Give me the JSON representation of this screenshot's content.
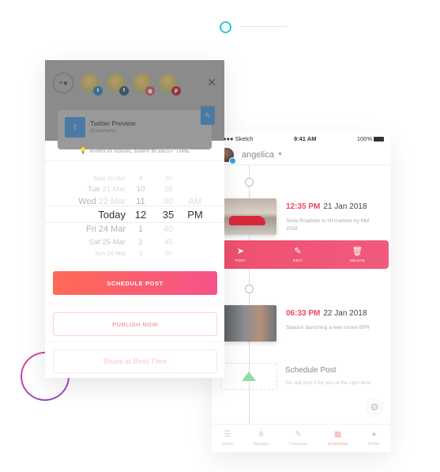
{
  "right_phone": {
    "status": {
      "carrier": "●●● Sketch",
      "time": "9:41 AM",
      "battery": "100%"
    },
    "username": "angelica",
    "posts": [
      {
        "time": "12:35 PM",
        "date": "21 Jan 2018",
        "description": "Tesla Roadster to hit markets by Mid 2018"
      },
      {
        "time": "06:33 PM",
        "date": "22 Jan 2018",
        "description": "SpaceX launching a new rocket BFR"
      }
    ],
    "actions": [
      {
        "label": "POST",
        "icon": "paper-plane-icon"
      },
      {
        "label": "EDIT",
        "icon": "pencil-icon"
      },
      {
        "label": "DELETE",
        "icon": "trash-icon"
      }
    ],
    "schedule_placeholder": {
      "title": "Schedule Post",
      "subtitle": "We will post it for you at the right time"
    },
    "tabs": [
      {
        "label": "Home",
        "icon": "list-icon",
        "active": false
      },
      {
        "label": "Manage",
        "icon": "network-icon",
        "active": false
      },
      {
        "label": "Compose",
        "icon": "compose-icon",
        "active": false
      },
      {
        "label": "Scheduled",
        "icon": "calendar-clock-icon",
        "active": true
      },
      {
        "label": "Profile",
        "icon": "person-icon",
        "active": false
      }
    ]
  },
  "left_phone": {
    "accounts": [
      {
        "network": "twitter",
        "color": "#34a5e9",
        "glyph": "t"
      },
      {
        "network": "facebook",
        "color": "#3b5998",
        "glyph": "f"
      },
      {
        "network": "instagram",
        "color": "#e1306c",
        "glyph": "◎"
      },
      {
        "network": "pinterest",
        "color": "#cb2027",
        "glyph": "p"
      }
    ],
    "preview": {
      "title": "Twitter Preview",
      "username": "@username"
    },
    "hint": "When in doubt, share at BEST TIME",
    "picker": {
      "rows": [
        {
          "day": "Mon",
          "date": "20 Mar",
          "hour": "9",
          "minute": "20",
          "ampm": ""
        },
        {
          "day": "Tue",
          "date": "21 Mar",
          "hour": "10",
          "minute": "25",
          "ampm": ""
        },
        {
          "day": "Wed",
          "date": "22 Mar",
          "hour": "11",
          "minute": "30",
          "ampm": "AM"
        },
        {
          "day": "Today",
          "date": "",
          "hour": "12",
          "minute": "35",
          "ampm": "PM"
        },
        {
          "day": "Fri",
          "date": "24 Mar",
          "hour": "1",
          "minute": "40",
          "ampm": ""
        },
        {
          "day": "Sat",
          "date": "25 Mar",
          "hour": "2",
          "minute": "45",
          "ampm": ""
        },
        {
          "day": "Sun",
          "date": "26 Mar",
          "hour": "3",
          "minute": "50",
          "ampm": ""
        }
      ]
    },
    "buttons": {
      "schedule": "SCHEDULE POST",
      "publish": "PUBLISH NOW",
      "best_time": "Share at Best Time"
    }
  },
  "colors": {
    "accent": "#ef4562",
    "gradient_start": "#ff6a55",
    "gradient_end": "#f5538a",
    "twitter": "#34a5e9"
  }
}
